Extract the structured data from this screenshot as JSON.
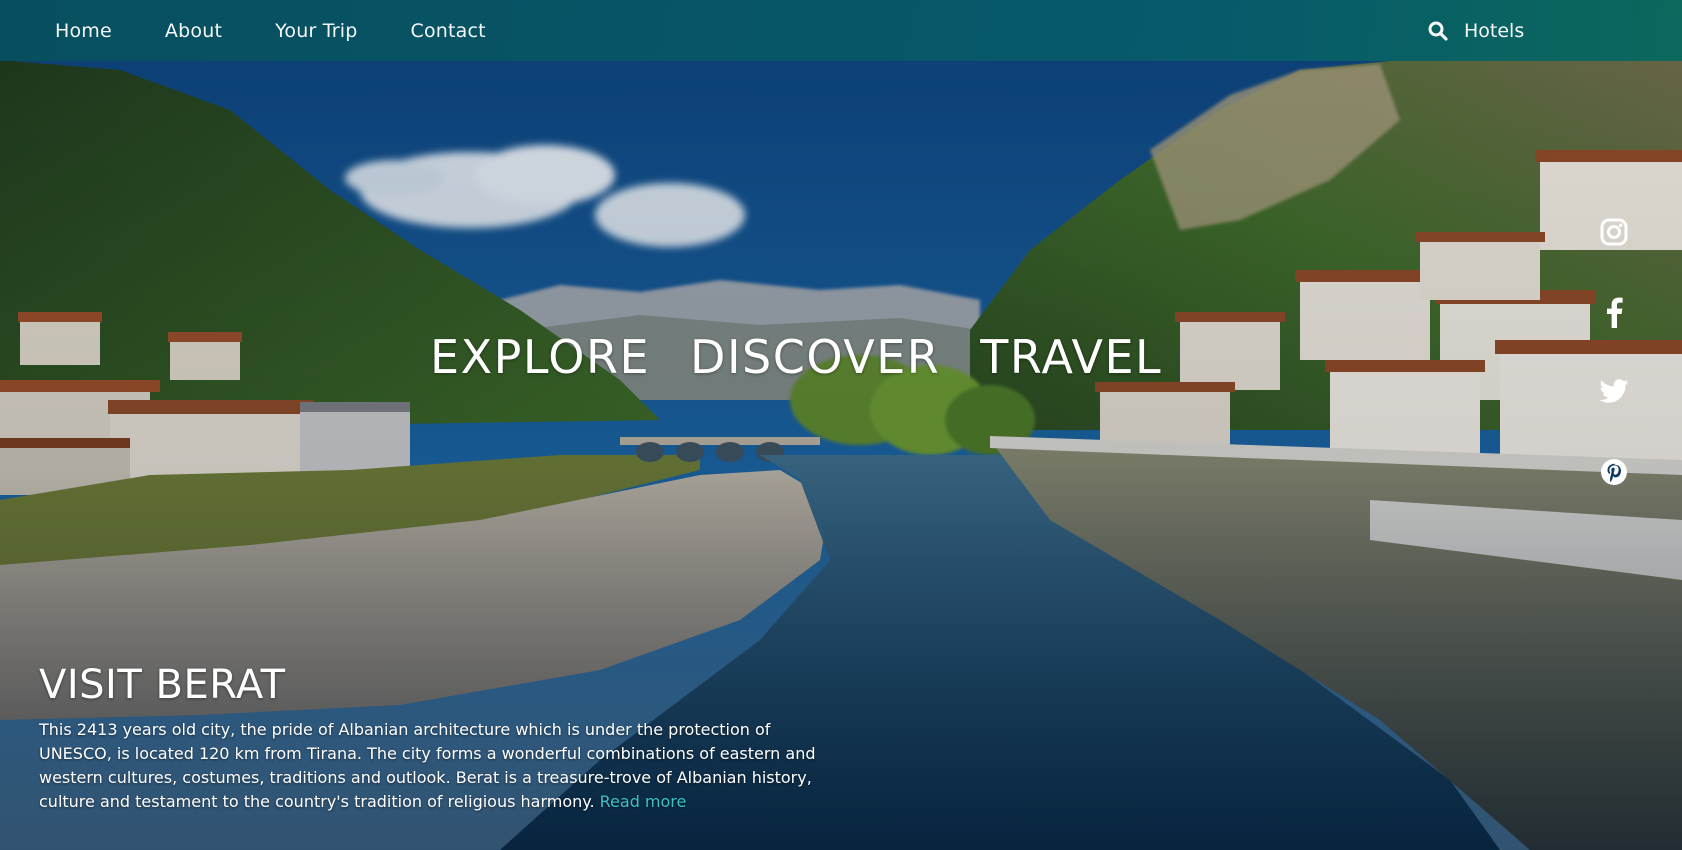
{
  "nav": {
    "links": [
      "Home",
      "About",
      "Your Trip",
      "Contact"
    ],
    "hotels_label": "Hotels",
    "search_icon": "search-icon",
    "bar_color": "#075a6b"
  },
  "hero": {
    "headline_words": [
      "EXPLORE",
      "DISCOVER",
      "TRAVEL"
    ]
  },
  "social": {
    "icons": [
      "instagram-icon",
      "facebook-icon",
      "twitter-icon",
      "pinterest-icon"
    ]
  },
  "visit": {
    "title": "VISIT BERAT",
    "body": "This 2413 years old city, the pride of Albanian architecture which is under the protection of UNESCO, is located 120 km from Tirana. The city forms a wonderful combinations of eastern and western cultures, costumes, traditions and outlook. Berat is a treasure-trove of Albanian history, culture and testament to the country's tradition of religious harmony.",
    "read_more_label": "Read more",
    "link_color": "#3ec1c9"
  }
}
